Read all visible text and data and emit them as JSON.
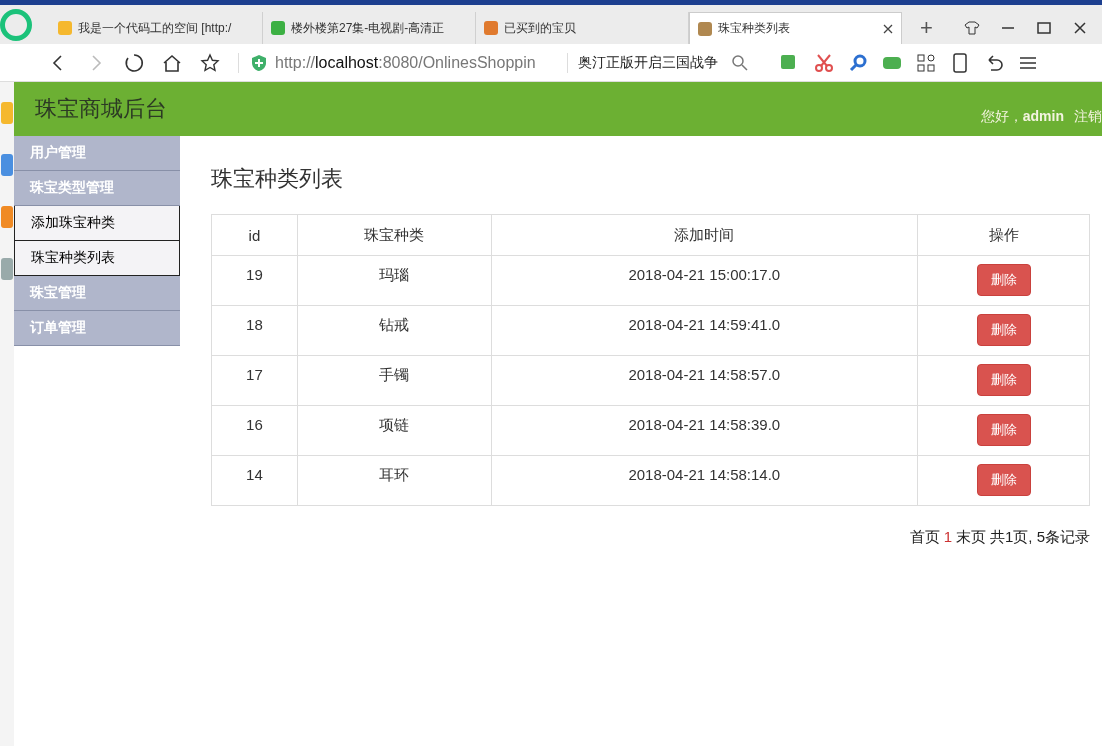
{
  "browser": {
    "tabs": [
      {
        "title": "我是一个代码工的空间 [http:/",
        "selected": false
      },
      {
        "title": "楼外楼第27集-电视剧-高清正",
        "selected": false
      },
      {
        "title": "已买到的宝贝",
        "selected": false
      },
      {
        "title": "珠宝种类列表",
        "selected": true
      }
    ],
    "new_tab": "+",
    "url_prefix": "http://",
    "url_host": "localhost",
    "url_rest": ":8080/OnlinesShoppin",
    "search_text": "奥汀正版开启三国战争"
  },
  "header": {
    "title": "珠宝商城后台",
    "greeting": "您好，",
    "user": "admin",
    "logout": "注销"
  },
  "sidebar": {
    "items": [
      {
        "label": "用户管理",
        "kind": "group"
      },
      {
        "label": "珠宝类型管理",
        "kind": "group"
      },
      {
        "label": "添加珠宝种类",
        "kind": "link"
      },
      {
        "label": "珠宝种类列表",
        "kind": "link"
      },
      {
        "label": "珠宝管理",
        "kind": "group"
      },
      {
        "label": "订单管理",
        "kind": "group"
      }
    ]
  },
  "content": {
    "title": "珠宝种类列表",
    "table": {
      "columns": [
        "id",
        "珠宝种类",
        "添加时间",
        "操作"
      ],
      "rows": [
        {
          "id": "19",
          "name": "玛瑙",
          "time": "2018-04-21 15:00:17.0",
          "action": "删除"
        },
        {
          "id": "18",
          "name": "钻戒",
          "time": "2018-04-21 14:59:41.0",
          "action": "删除"
        },
        {
          "id": "17",
          "name": "手镯",
          "time": "2018-04-21 14:58:57.0",
          "action": "删除"
        },
        {
          "id": "16",
          "name": "项链",
          "time": "2018-04-21 14:58:39.0",
          "action": "删除"
        },
        {
          "id": "14",
          "name": "耳环",
          "time": "2018-04-21 14:58:14.0",
          "action": "删除"
        }
      ]
    },
    "pagination": {
      "first": "首页",
      "current": "1",
      "last": "末页",
      "summary": "共1页, 5条记录"
    }
  }
}
